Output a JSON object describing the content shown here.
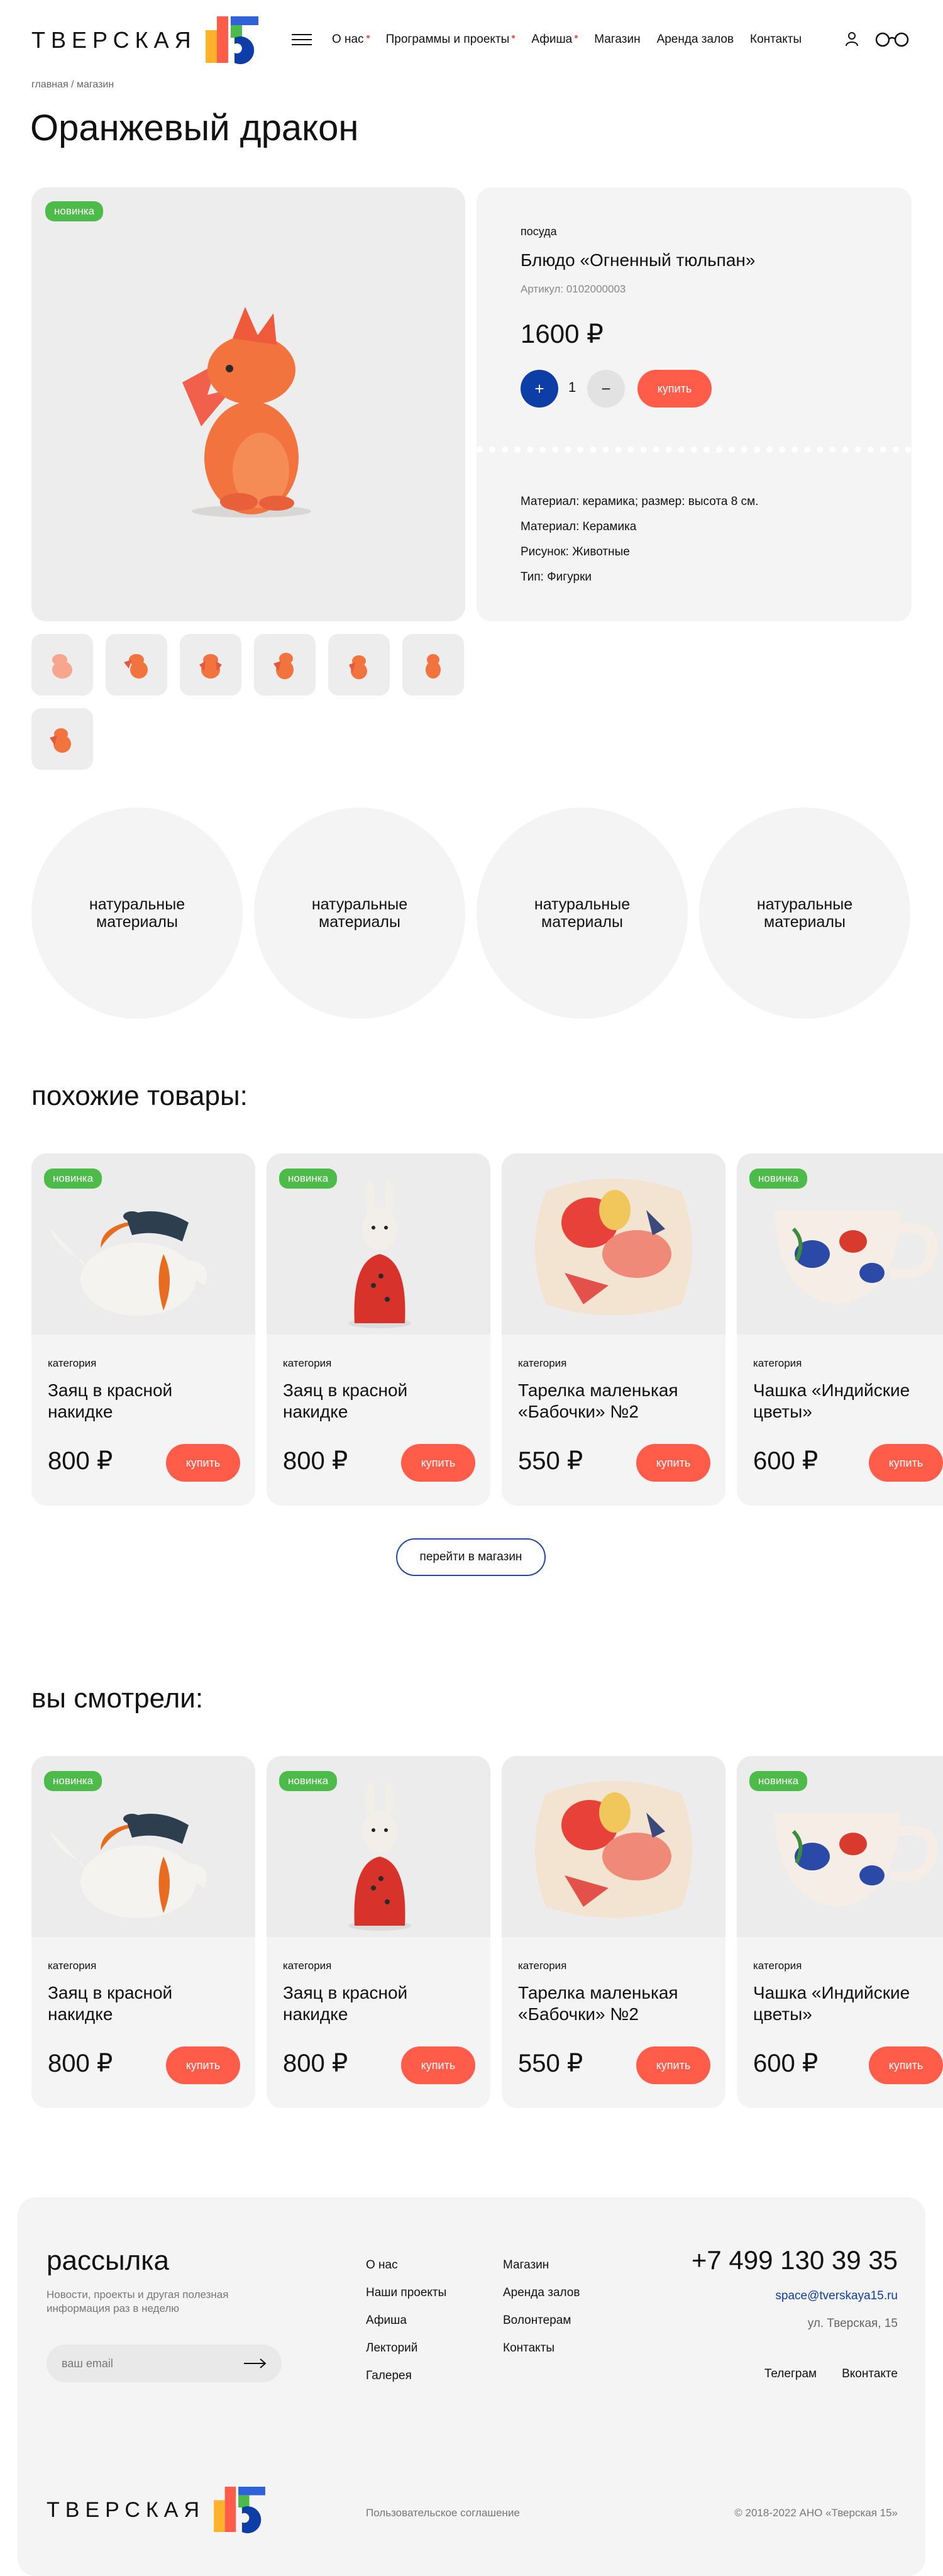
{
  "header": {
    "logo_text": "ТВЕРСКАЯ",
    "nav": [
      {
        "label": "О нас",
        "dot": true
      },
      {
        "label": "Программы и проекты",
        "dot": true
      },
      {
        "label": "Афиша",
        "dot": true
      },
      {
        "label": "Магазин",
        "dot": false
      },
      {
        "label": "Аренда залов",
        "dot": false
      },
      {
        "label": "Контакты",
        "dot": false
      }
    ]
  },
  "breadcrumb": "главная / магазин",
  "page_title": "Оранжевый дракон",
  "product": {
    "badge": "новинка",
    "category": "посуда",
    "name": "Блюдо «Огненный тюльпан»",
    "sku": "Артикул: 0102000003",
    "price": "1600 ₽",
    "quantity": "1",
    "plus": "+",
    "minus": "−",
    "buy": "купить",
    "specs": [
      "Материал: керамика; размер: высота 8 см.",
      "Материал: Керамика",
      "Рисунок: Животные",
      "Тип: Фигурки"
    ]
  },
  "features": [
    "натуральные материалы",
    "натуральные материалы",
    "натуральные материалы",
    "натуральные материалы"
  ],
  "similar": {
    "title": "похожие товары:",
    "items": [
      {
        "badge": "новинка",
        "category": "категория",
        "title": "Заяц в красной накидке",
        "price": "800 ₽",
        "buy": "купить"
      },
      {
        "badge": "новинка",
        "category": "категория",
        "title": "Заяц в красной накидке",
        "price": "800 ₽",
        "buy": "купить"
      },
      {
        "badge": "",
        "category": "категория",
        "title": "Тарелка маленькая «Бабочки» №2",
        "price": "550 ₽",
        "buy": "купить"
      },
      {
        "badge": "новинка",
        "category": "категория",
        "title": "Чашка «Индийские цветы»",
        "price": "600 ₽",
        "buy": "купить"
      }
    ],
    "shop_button": "перейти в магазин"
  },
  "viewed": {
    "title": "вы смотрели:",
    "items": [
      {
        "badge": "новинка",
        "category": "категория",
        "title": "Заяц в красной накидке",
        "price": "800 ₽",
        "buy": "купить"
      },
      {
        "badge": "новинка",
        "category": "категория",
        "title": "Заяц в красной накидке",
        "price": "800 ₽",
        "buy": "купить"
      },
      {
        "badge": "",
        "category": "категория",
        "title": "Тарелка маленькая «Бабочки» №2",
        "price": "550 ₽",
        "buy": "купить"
      },
      {
        "badge": "новинка",
        "category": "категория",
        "title": "Чашка «Индийские цветы»",
        "price": "600 ₽",
        "buy": "купить"
      }
    ]
  },
  "footer": {
    "newsletter_title": "рассылка",
    "newsletter_text": "Новости, проекты и другая полезная информация раз в неделю",
    "email_placeholder": "ваш email",
    "links_col1": [
      "О нас",
      "Наши проекты",
      "Афиша",
      "Лекторий",
      "Галерея"
    ],
    "links_col2": [
      "Магазин",
      "Аренда залов",
      "Волонтерам",
      "Контакты"
    ],
    "phone": "+7 499 130 39 35",
    "email": "space@tverskaya15.ru",
    "address": "ул. Тверская, 15",
    "social": [
      "Телеграм",
      "Вконтакте"
    ],
    "logo_text": "ТВЕРСКАЯ",
    "agreement": "Пользовательское соглашение",
    "copyright": "© 2018-2022 АНО «Тверская 15»"
  },
  "colors": {
    "accent": "#ff5c4a",
    "badge": "#4cbb4a",
    "blue": "#0d3da6",
    "panel": "#f4f4f4"
  },
  "icons": [
    "menu-icon",
    "user-icon",
    "glasses-icon",
    "arrow-right-icon",
    "logo-15-icon"
  ]
}
